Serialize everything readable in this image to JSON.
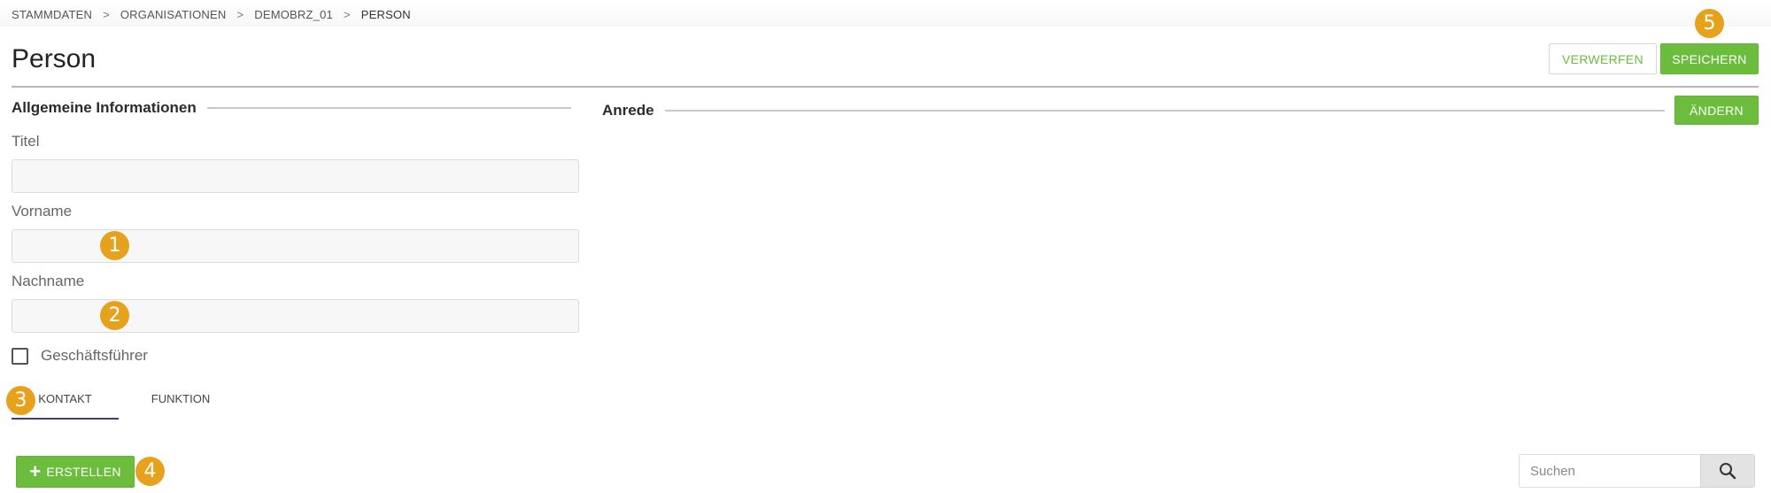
{
  "breadcrumb": {
    "items": [
      "STAMMDATEN",
      "ORGANISATIONEN",
      "DEMOBRZ_01",
      "PERSON"
    ],
    "separator": ">"
  },
  "page": {
    "title": "Person"
  },
  "header_buttons": {
    "discard_label": "VERWERFEN",
    "save_label": "SPEICHERN"
  },
  "sections": {
    "general": {
      "title": "Allgemeine Informationen"
    },
    "salutation": {
      "title": "Anrede",
      "change_label": "ÄNDERN"
    }
  },
  "form": {
    "titel": {
      "label": "Titel",
      "value": ""
    },
    "vorname": {
      "label": "Vorname",
      "value": ""
    },
    "nachname": {
      "label": "Nachname",
      "value": ""
    },
    "managing_director": {
      "label": "Geschäftsführer",
      "checked": false
    }
  },
  "tabs": [
    {
      "label": "KONTAKT",
      "active": true
    },
    {
      "label": "FUNKTION",
      "active": false
    }
  ],
  "toolbar": {
    "create_label": "ERSTELLEN",
    "create_icon": "plus-icon"
  },
  "search": {
    "placeholder": "Suchen",
    "icon": "search-icon"
  },
  "markers": [
    "1",
    "2",
    "3",
    "4",
    "5"
  ],
  "colors": {
    "accent_green": "#6cbd3e",
    "marker_orange": "#e6a11d",
    "tab_underline": "#3d3f7a"
  }
}
